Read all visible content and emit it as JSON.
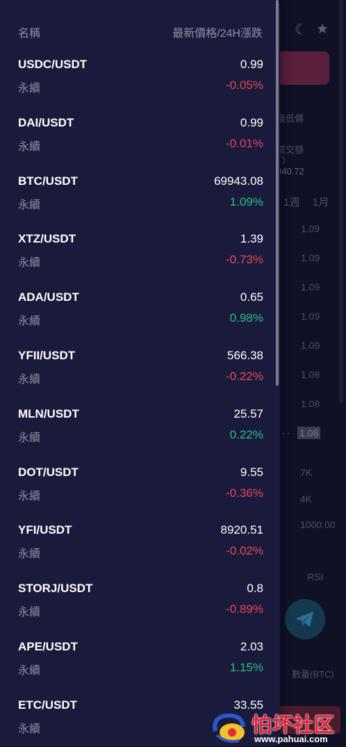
{
  "background": {
    "low_label": "最低價",
    "volume_label": "成交額",
    "volume_unit": "T)",
    "volume_value": "040.72",
    "range_week": "1週",
    "range_month": "1月",
    "depth_prices": [
      "1.09",
      "1.09",
      "1.09",
      "1.09",
      "1.09",
      "1.08",
      "1.08"
    ],
    "current_price_tag": "1.08",
    "volume_axis": [
      "7K",
      "4K",
      "1000.00"
    ],
    "indicator": "RSI",
    "qty_label": "數量(BTC)"
  },
  "header": {
    "name_col": "名稱",
    "price_col": "最新價格/24H漲跌"
  },
  "pairs": [
    {
      "symbol": "USDC/USDT",
      "type": "永續",
      "price": "0.99",
      "change": "-0.05%",
      "dir": "neg"
    },
    {
      "symbol": "DAI/USDT",
      "type": "永續",
      "price": "0.99",
      "change": "-0.01%",
      "dir": "neg"
    },
    {
      "symbol": "BTC/USDT",
      "type": "永續",
      "price": "69943.08",
      "change": "1.09%",
      "dir": "pos"
    },
    {
      "symbol": "XTZ/USDT",
      "type": "永續",
      "price": "1.39",
      "change": "-0.73%",
      "dir": "neg"
    },
    {
      "symbol": "ADA/USDT",
      "type": "永續",
      "price": "0.65",
      "change": "0.98%",
      "dir": "pos"
    },
    {
      "symbol": "YFII/USDT",
      "type": "永續",
      "price": "566.38",
      "change": "-0.22%",
      "dir": "neg"
    },
    {
      "symbol": "MLN/USDT",
      "type": "永續",
      "price": "25.57",
      "change": "0.22%",
      "dir": "pos"
    },
    {
      "symbol": "DOT/USDT",
      "type": "永續",
      "price": "9.55",
      "change": "-0.36%",
      "dir": "neg"
    },
    {
      "symbol": "YFI/USDT",
      "type": "永續",
      "price": "8920.51",
      "change": "-0.02%",
      "dir": "neg"
    },
    {
      "symbol": "STORJ/USDT",
      "type": "永續",
      "price": "0.8",
      "change": "-0.89%",
      "dir": "neg"
    },
    {
      "symbol": "APE/USDT",
      "type": "永續",
      "price": "2.03",
      "change": "1.15%",
      "dir": "pos"
    },
    {
      "symbol": "ETC/USDT",
      "type": "永續",
      "price": "33.55",
      "change": "",
      "dir": "neg"
    }
  ],
  "watermark": {
    "title": "怕坏社区",
    "url": "www.pahuai.com"
  },
  "colors": {
    "drawer": "#1a1b3c",
    "negative": "#e8455c",
    "positive": "#2ebd85"
  }
}
